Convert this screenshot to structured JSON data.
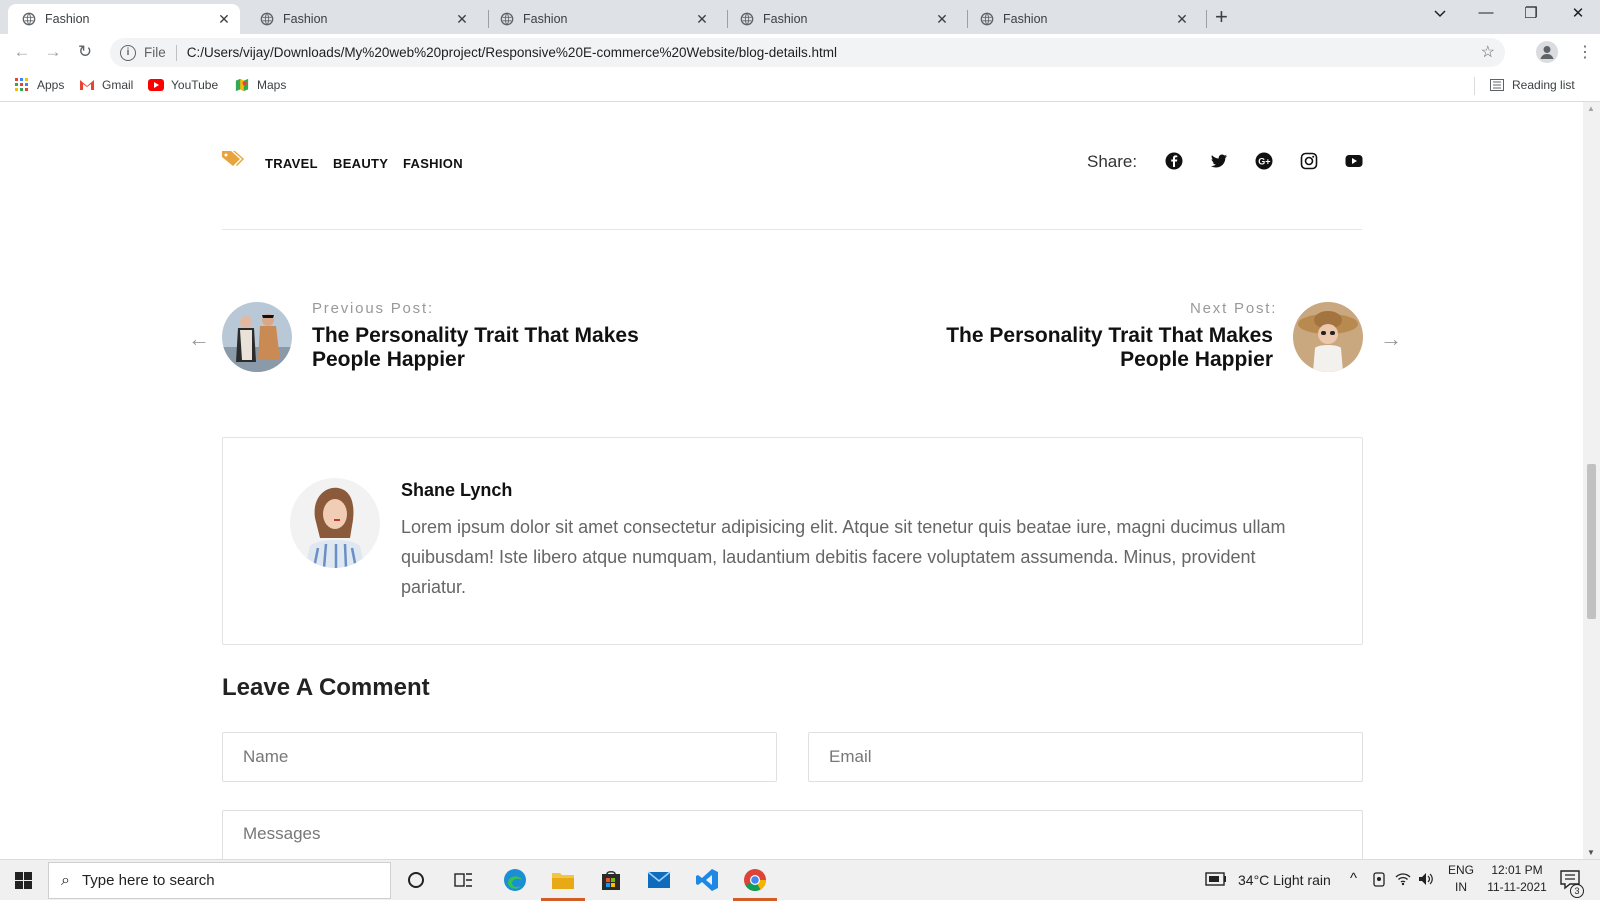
{
  "browser": {
    "tabs": [
      {
        "title": "Fashion",
        "active": true
      },
      {
        "title": "Fashion",
        "active": false
      },
      {
        "title": "Fashion",
        "active": false
      },
      {
        "title": "Fashion",
        "active": false
      },
      {
        "title": "Fashion",
        "active": false
      }
    ],
    "new_tab_label": "+",
    "address": {
      "scheme_label": "File",
      "url": "C:/Users/vijay/Downloads/My%20web%20project/Responsive%20E-commerce%20Website/blog-details.html"
    },
    "bookmarks": [
      {
        "label": "Apps",
        "icon": "apps-grid-icon"
      },
      {
        "label": "Gmail",
        "icon": "gmail-icon"
      },
      {
        "label": "YouTube",
        "icon": "youtube-icon"
      },
      {
        "label": "Maps",
        "icon": "maps-icon"
      }
    ],
    "reading_list_label": "Reading list"
  },
  "page": {
    "tags": [
      "TRAVEL",
      "BEAUTY",
      "FASHION"
    ],
    "share_label": "Share:",
    "social_icons": [
      "facebook-icon",
      "twitter-icon",
      "google-plus-icon",
      "instagram-icon",
      "youtube-icon"
    ],
    "previous_post": {
      "caption": "Previous Post:",
      "title": "The Personality Trait That Makes People Happier"
    },
    "next_post": {
      "caption": "Next Post:",
      "title": "The Personality Trait That Makes People Happier"
    },
    "author": {
      "name": "Shane Lynch",
      "bio": "Lorem ipsum dolor sit amet consectetur adipisicing elit. Atque sit tenetur quis beatae iure, magni ducimus ullam quibusdam! Iste libero atque numquam, laudantium debitis facere voluptatem assumenda. Minus, provident pariatur."
    },
    "comment": {
      "heading": "Leave A Comment",
      "name_placeholder": "Name",
      "email_placeholder": "Email",
      "message_placeholder": "Messages"
    },
    "colors": {
      "tag_icon": "#e8a33d",
      "text_dark": "#111111",
      "muted": "#999999"
    }
  },
  "taskbar": {
    "search_placeholder": "Type here to search",
    "weather": "34°C  Light rain",
    "language_top": "ENG",
    "language_bottom": "IN",
    "time": "12:01 PM",
    "date": "11-11-2021",
    "notification_count": "3"
  }
}
